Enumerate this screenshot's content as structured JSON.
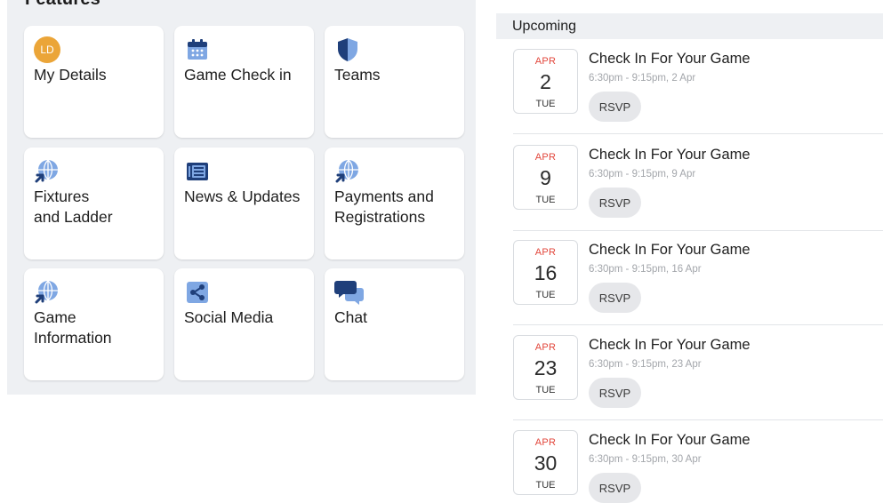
{
  "features": {
    "title": "Features",
    "tiles": [
      {
        "label": "My Details",
        "icon": "avatar-initials",
        "initials": "LD"
      },
      {
        "label": "Game Check in",
        "icon": "calendar-icon"
      },
      {
        "label": "Teams",
        "icon": "shield-icon"
      },
      {
        "label": "Fixtures\nand Ladder",
        "icon": "globe-cursor-icon"
      },
      {
        "label": "News & Updates",
        "icon": "newspaper-icon"
      },
      {
        "label": "Payments and\nRegistrations",
        "icon": "globe-cursor-icon"
      },
      {
        "label": "Game\nInformation",
        "icon": "globe-cursor-icon"
      },
      {
        "label": "Social Media",
        "icon": "share-icon"
      },
      {
        "label": "Chat",
        "icon": "chat-bubbles-icon"
      }
    ]
  },
  "upcoming": {
    "title": "Upcoming",
    "events": [
      {
        "month": "APR",
        "day": "2",
        "weekday": "TUE",
        "title": "Check In For Your Game",
        "time": "6:30pm - 9:15pm, 2 Apr",
        "action": "RSVP"
      },
      {
        "month": "APR",
        "day": "9",
        "weekday": "TUE",
        "title": "Check In For Your Game",
        "time": "6:30pm - 9:15pm, 9 Apr",
        "action": "RSVP"
      },
      {
        "month": "APR",
        "day": "16",
        "weekday": "TUE",
        "title": "Check In For Your Game",
        "time": "6:30pm - 9:15pm, 16 Apr",
        "action": "RSVP"
      },
      {
        "month": "APR",
        "day": "23",
        "weekday": "TUE",
        "title": "Check In For Your Game",
        "time": "6:30pm - 9:15pm, 23 Apr",
        "action": "RSVP"
      },
      {
        "month": "APR",
        "day": "30",
        "weekday": "TUE",
        "title": "Check In For Your Game",
        "time": "6:30pm - 9:15pm, 30 Apr",
        "action": "RSVP"
      }
    ]
  },
  "colors": {
    "accent": "#1f3f7a",
    "icon_light": "#7fa7e3",
    "avatar": "#eba538",
    "month": "#e2463b",
    "panel_bg": "#eef0f3"
  }
}
